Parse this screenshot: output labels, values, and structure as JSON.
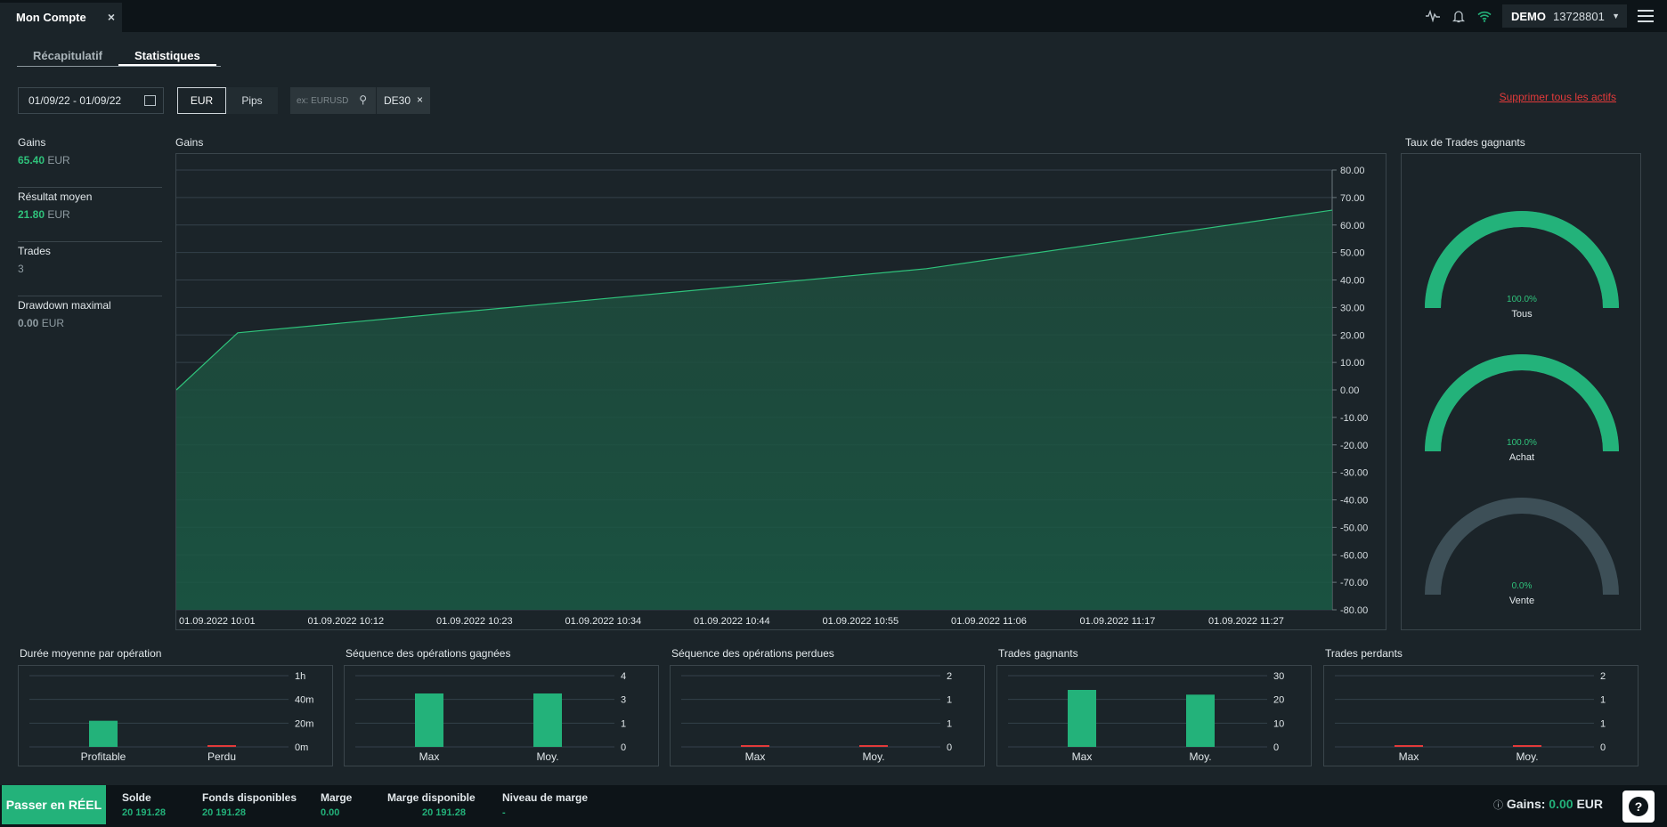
{
  "window": {
    "tab_title": "Mon Compte",
    "tab_close": "×"
  },
  "account": {
    "mode": "DEMO",
    "number": "13728801"
  },
  "subtabs": {
    "summary": "Récapitulatif",
    "statistics": "Statistiques"
  },
  "filters": {
    "date_range": "01/09/22 - 01/09/22",
    "unit_eur": "EUR",
    "unit_pips": "Pips",
    "search_placeholder": "ex: EURUSD",
    "chip": "DE30",
    "chip_close": "×",
    "delete_all": "Supprimer tous les actifs"
  },
  "stats": [
    {
      "label": "Gains",
      "value": "65.40",
      "unit": "EUR",
      "positive": true
    },
    {
      "label": "Résultat moyen",
      "value": "21.80",
      "unit": "EUR",
      "positive": true
    },
    {
      "label": "Trades",
      "value": "3",
      "unit": "",
      "positive": false
    },
    {
      "label": "Drawdown maximal",
      "value": "0.00",
      "unit": "EUR",
      "positive": false
    }
  ],
  "colors": {
    "accent": "#23b27a",
    "loss": "#e23a3a",
    "panel": "#1b2429",
    "gauge_empty": "#3d4f57"
  },
  "win_rate": {
    "title": "Taux de Trades gagnants",
    "gauges": [
      {
        "label": "Tous",
        "value": "100.0%",
        "fraction": 1
      },
      {
        "label": "Achat",
        "value": "100.0%",
        "fraction": 1
      },
      {
        "label": "Vente",
        "value": "0.0%",
        "fraction": 0
      }
    ]
  },
  "chart_data": [
    {
      "type": "area",
      "title": "Gains",
      "x": [
        "01.09.2022 10:01",
        "01.09.2022 10:06",
        "01.09.2022 11:02",
        "01.09.2022 11:35"
      ],
      "y": [
        0,
        20.8,
        44.1,
        65.4
      ],
      "x_ticks": [
        "01.09.2022 10:01",
        "01.09.2022 10:12",
        "01.09.2022 10:23",
        "01.09.2022 10:34",
        "01.09.2022 10:44",
        "01.09.2022 10:55",
        "01.09.2022 11:06",
        "01.09.2022 11:17",
        "01.09.2022 11:27"
      ],
      "y_ticks": [
        "80.00",
        "70.00",
        "60.00",
        "50.00",
        "40.00",
        "30.00",
        "20.00",
        "10.00",
        "0.00",
        "-10.00",
        "-20.00",
        "-30.00",
        "-40.00",
        "-50.00",
        "-60.00",
        "-70.00",
        "-80.00"
      ],
      "ylim": [
        -80,
        80
      ],
      "grid": true
    },
    {
      "type": "bar",
      "title": "Durée moyenne par opération",
      "categories": [
        "Profitable",
        "Perdu"
      ],
      "values": [
        22,
        1
      ],
      "unit": "minutes",
      "y_ticks": [
        "1h",
        "40m",
        "20m",
        "0m"
      ],
      "ylim": [
        0,
        60
      ]
    },
    {
      "type": "bar",
      "title": "Séquence des opérations gagnées",
      "categories": [
        "Max",
        "Moy."
      ],
      "values": [
        3,
        3
      ],
      "y_ticks": [
        "4",
        "3",
        "1",
        "0"
      ],
      "ylim": [
        0,
        4
      ]
    },
    {
      "type": "bar",
      "title": "Séquence des opérations perdues",
      "categories": [
        "Max",
        "Moy."
      ],
      "values": [
        0.02,
        0.02
      ],
      "y_ticks": [
        "2",
        "1",
        "1",
        "0"
      ],
      "ylim": [
        0,
        2
      ]
    },
    {
      "type": "bar",
      "title": "Trades gagnants",
      "categories": [
        "Max",
        "Moy."
      ],
      "values": [
        24,
        22
      ],
      "y_ticks": [
        "30",
        "20",
        "10",
        "0"
      ],
      "ylim": [
        0,
        30
      ]
    },
    {
      "type": "bar",
      "title": "Trades perdants",
      "categories": [
        "Max",
        "Moy."
      ],
      "values": [
        0.02,
        0.02
      ],
      "y_ticks": [
        "2",
        "1",
        "1",
        "0"
      ],
      "ylim": [
        0,
        2
      ]
    }
  ],
  "footer": {
    "go_real": "Passer en RÉEL",
    "balance_label": "Solde",
    "balance": "20 191.28",
    "funds_label": "Fonds disponibles",
    "funds": "20 191.28",
    "margin_label": "Marge",
    "margin": "0.00",
    "free_margin_label": "Marge disponible",
    "free_margin": "20 191.28",
    "margin_level_label": "Niveau de marge",
    "margin_level": "-",
    "gains_label": "Gains:",
    "gains_value": "0.00",
    "gains_unit": "EUR",
    "help": "?"
  }
}
